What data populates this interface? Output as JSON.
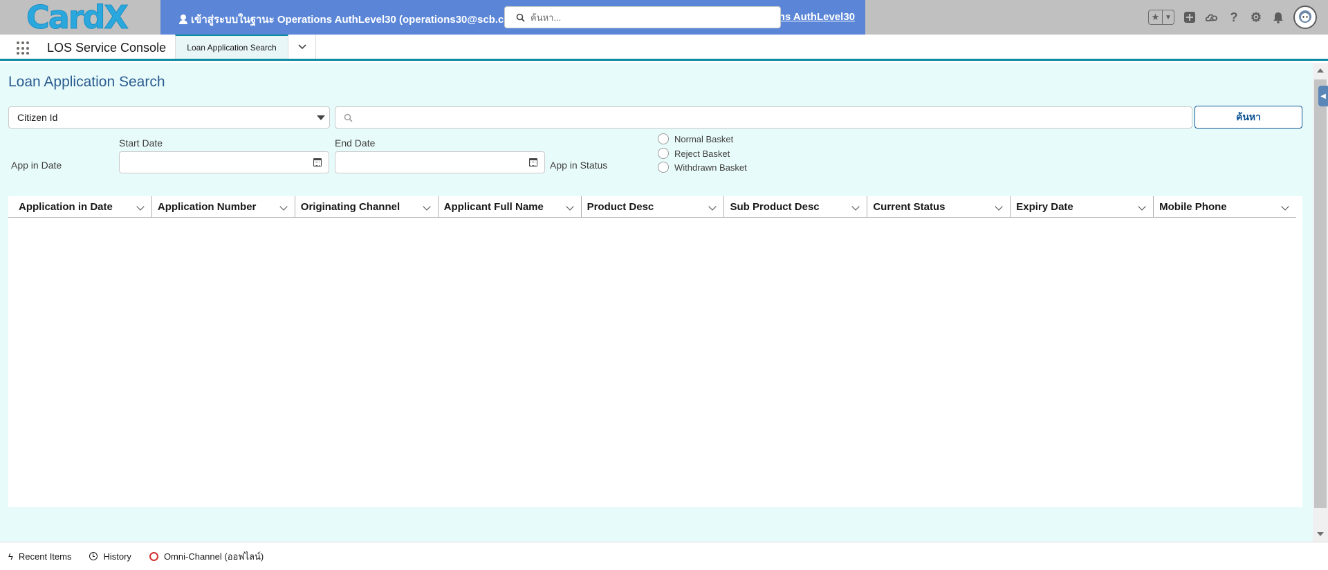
{
  "header": {
    "logo_text": "CardX",
    "banner_left": "เข้าสู่ระบบในฐานะ Operations AuthLevel30 (operations30@scb.ca",
    "banner_right": "ns AuthLevel30",
    "search_placeholder": "ค้นหา...",
    "icons": [
      "favorites-star-icon",
      "favorites-dropdown-icon",
      "global-actions-plus-icon",
      "trailhead-icon",
      "help-icon",
      "setup-gear-icon",
      "notifications-bell-icon",
      "user-avatar"
    ]
  },
  "nav": {
    "app_name": "LOS Service Console",
    "tabs": [
      {
        "label": "Loan Application Search"
      }
    ]
  },
  "page": {
    "title": "Loan Application Search",
    "search_field_selected": "Citizen Id",
    "search_input_value": "",
    "search_button": "ค้นหา",
    "app_in_date_label": "App in Date",
    "start_date_label": "Start Date",
    "end_date_label": "End Date",
    "app_in_status_label": "App in Status",
    "status_options": [
      "Normal Basket",
      "Reject Basket",
      "Withdrawn Basket"
    ]
  },
  "table": {
    "columns": [
      "Application in Date",
      "Application Number",
      "Originating Channel",
      "Applicant Full Name",
      "Product Desc",
      "Sub Product Desc",
      "Current Status",
      "Expiry Date",
      "Mobile Phone"
    ],
    "rows": []
  },
  "utility_bar": {
    "items": [
      {
        "label": "Recent Items",
        "icon": "bolt-icon"
      },
      {
        "label": "History",
        "icon": "clock-icon"
      },
      {
        "label": "Omni-Channel (ออฟไลน์)",
        "icon": "omni-status-icon"
      }
    ]
  },
  "colors": {
    "banner": "#5b86d8",
    "workspace_bg": "#e8fbfb",
    "accent": "#0b8ba1",
    "title": "#2a5b8f"
  }
}
